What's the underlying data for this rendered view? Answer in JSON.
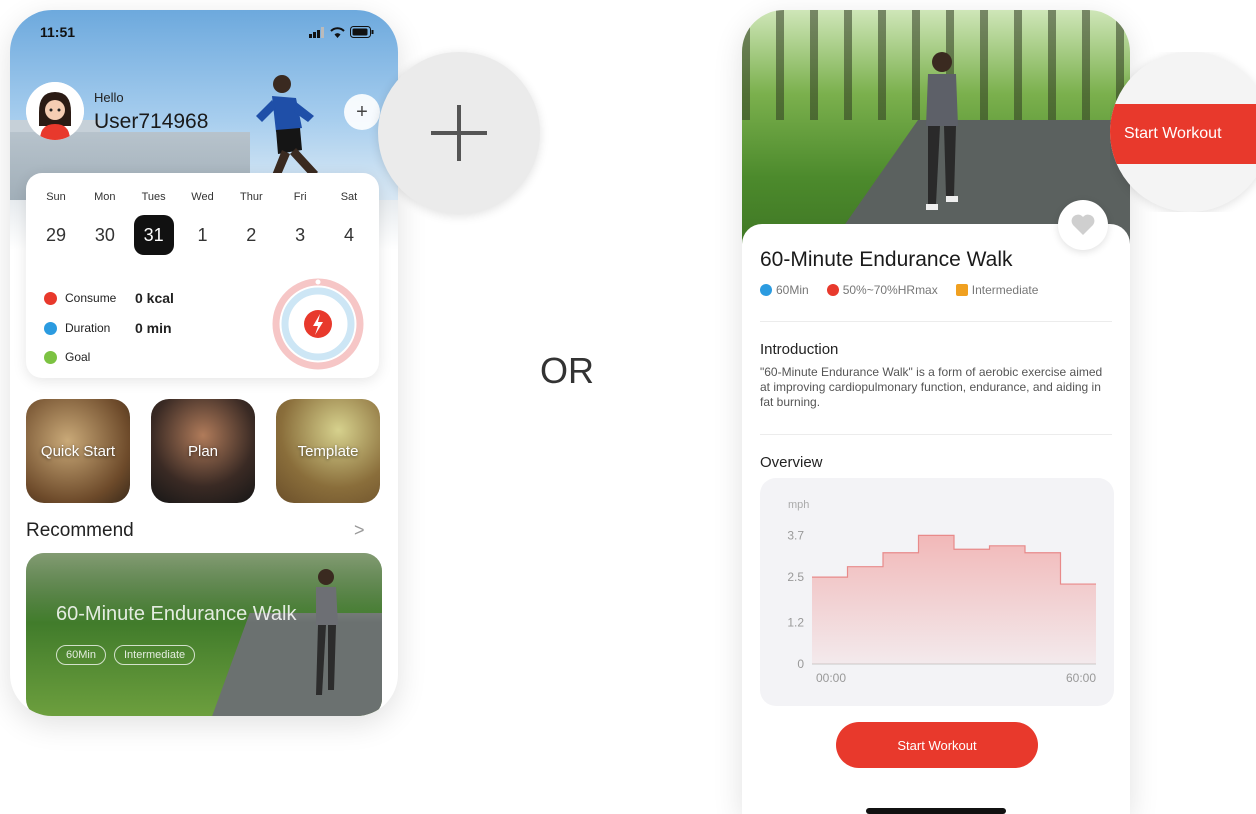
{
  "left_phone": {
    "status": {
      "time": "11:51"
    },
    "greeting": "Hello",
    "username": "User714968",
    "add_label": "+",
    "calendar": {
      "days": [
        "Sun",
        "Mon",
        "Tues",
        "Wed",
        "Thur",
        "Fri",
        "Sat"
      ],
      "dates": [
        "29",
        "30",
        "31",
        "1",
        "2",
        "3",
        "4"
      ],
      "selected": "31"
    },
    "stats": [
      {
        "label": "Consume",
        "value": "0 kcal",
        "color": "#e8392c"
      },
      {
        "label": "Duration",
        "value": "0 min",
        "color": "#2b9be0"
      },
      {
        "label": "Goal",
        "value": "",
        "color": "#7cc242"
      }
    ],
    "tiles": [
      {
        "label": "Quick Start"
      },
      {
        "label": "Plan"
      },
      {
        "label": "Template"
      }
    ],
    "recommend": {
      "title": "Recommend",
      "arrow": ">",
      "card_title": "60-Minute Endurance Walk",
      "badges": [
        "60Min",
        "Intermediate"
      ]
    }
  },
  "separator": "OR",
  "right_phone": {
    "title": "60-Minute Endurance Walk",
    "meta": [
      {
        "text": "60Min",
        "color": "#2b9be0"
      },
      {
        "text": "50%~70%HRmax",
        "color": "#e8392c"
      },
      {
        "text": "Intermediate",
        "color": "#f0a020"
      }
    ],
    "intro_title": "Introduction",
    "intro_text": "\"60-Minute Endurance Walk\" is a form of aerobic exercise aimed at improving cardiopulmonary function, endurance, and aiding in fat burning.",
    "overview_title": "Overview",
    "start_button": "Start Workout"
  },
  "zoom_button": "Start Workout",
  "chart_data": {
    "type": "area",
    "ylabel": "mph",
    "y_ticks": [
      "0",
      "1.2",
      "2.5",
      "3.7"
    ],
    "x_ticks": [
      "00:00",
      "60:00"
    ],
    "ylim": [
      0,
      4.2
    ],
    "values": [
      2.5,
      2.8,
      3.2,
      3.7,
      3.3,
      3.4,
      3.2,
      2.3
    ]
  },
  "colors": {
    "accent": "#e8392c",
    "chart_fill": "#f2b5b5",
    "chart_line": "#e88a8a"
  }
}
